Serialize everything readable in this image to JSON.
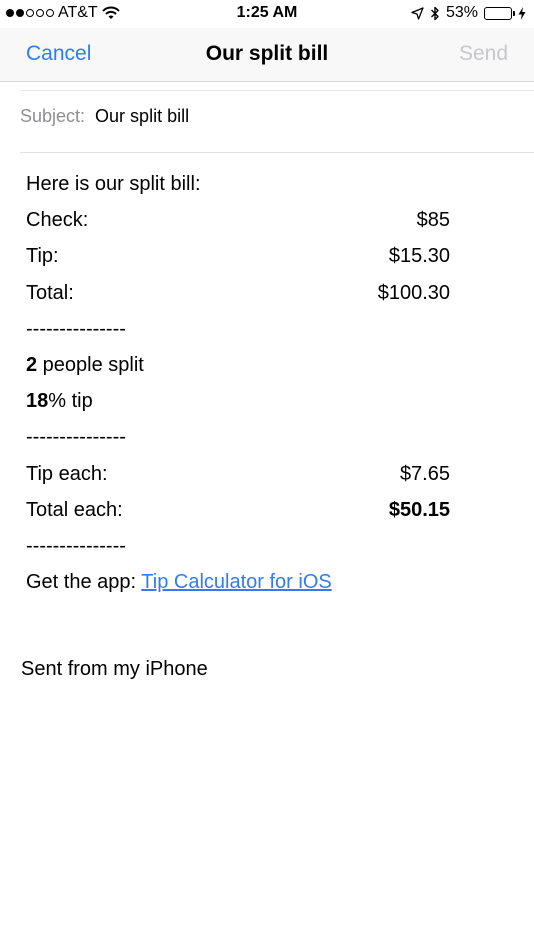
{
  "status_bar": {
    "carrier": "AT&T",
    "time": "1:25 AM",
    "battery_percent": "53%",
    "battery_level": 0.53,
    "battery_color": "#4cd964",
    "signal_bars_filled": 2,
    "signal_bars_total": 5,
    "icons": [
      "wifi-icon",
      "location-arrow-icon",
      "bluetooth-icon",
      "charging-bolt-icon"
    ]
  },
  "nav": {
    "cancel_label": "Cancel",
    "title": "Our split bill",
    "send_label": "Send",
    "accent_color": "#2f7cf6",
    "disabled_color": "#c7c7cc"
  },
  "subject": {
    "label": "Subject:",
    "value": "Our split bill"
  },
  "body": {
    "intro": "Here is our split bill:",
    "check_label": "Check:",
    "check_value": "$85",
    "tip_label": "Tip:",
    "tip_value": "$15.30",
    "total_label": "Total:",
    "total_value": "$100.30",
    "separator": "---------------",
    "people_count": "2",
    "people_text": " people split",
    "tip_percent": "18",
    "tip_percent_text": "% tip",
    "tip_each_label": "Tip each:",
    "tip_each_value": "$7.65",
    "total_each_label": "Total each:",
    "total_each_value": "$50.15",
    "app_prefix": "Get the app: ",
    "app_link": "Tip Calculator for iOS"
  },
  "signature": "Sent from my iPhone"
}
